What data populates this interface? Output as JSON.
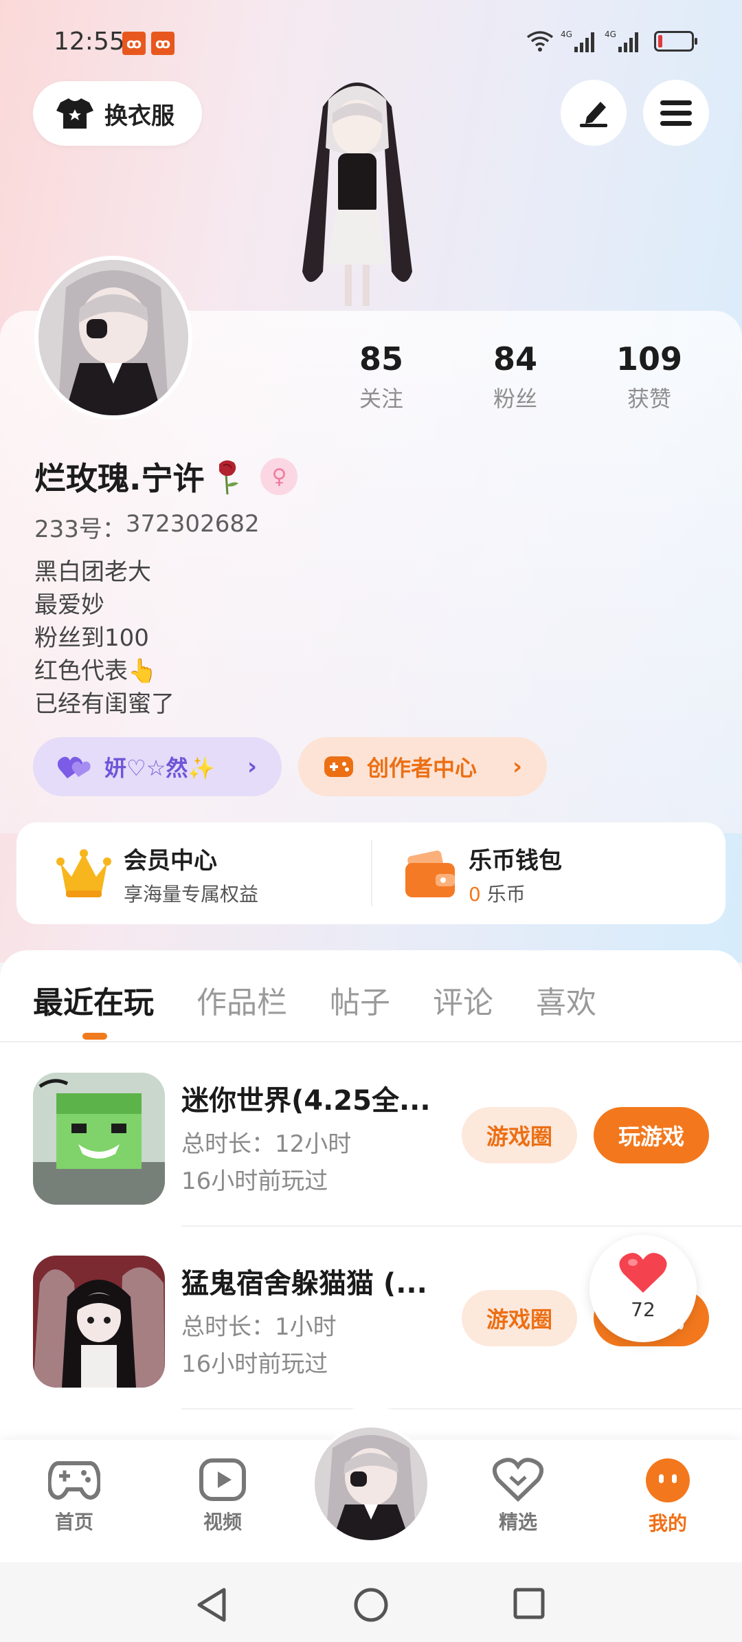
{
  "status_bar": {
    "time": "12:55",
    "notifications": [
      "app-badge",
      "app-badge"
    ],
    "network": [
      "wifi",
      "4G",
      "4G"
    ],
    "battery_level": 0.12
  },
  "top_bar": {
    "outfit_button_label": "换衣服"
  },
  "profile": {
    "stats": [
      {
        "value": "85",
        "label": "关注"
      },
      {
        "value": "84",
        "label": "粉丝"
      },
      {
        "value": "109",
        "label": "获赞"
      }
    ],
    "username": "烂玫瑰.宁许",
    "gender": "female",
    "uid_label": "233号：",
    "uid_value": "372302682",
    "bio_lines": [
      "黑白团老大",
      "最爱妙",
      "粉丝到100",
      "红色代表👆",
      "已经有闺蜜了"
    ],
    "partner_pill_label": "妍♡☆然✨",
    "creator_pill_label": "创作者中心"
  },
  "services": {
    "member": {
      "title": "会员中心",
      "subtitle": "享海量专属权益"
    },
    "wallet": {
      "title": "乐币钱包",
      "balance": "0",
      "unit": "乐币"
    }
  },
  "tabs": [
    {
      "label": "最近在玩",
      "active": true
    },
    {
      "label": "作品栏",
      "active": false
    },
    {
      "label": "帖子",
      "active": false
    },
    {
      "label": "评论",
      "active": false
    },
    {
      "label": "喜欢",
      "active": false
    }
  ],
  "games": [
    {
      "title": "迷你世界(4.25全...",
      "duration": "总时长：12小时",
      "last_played": "16小时前玩过",
      "circle_label": "游戏圈",
      "play_label": "玩游戏"
    },
    {
      "title": "猛鬼宿舍躲猫猫 (...",
      "duration": "总时长：1小时",
      "last_played": "16小时前玩过",
      "circle_label": "游戏圈",
      "play_label": "玩游戏"
    }
  ],
  "like_float": {
    "count": "72"
  },
  "bottom_nav": [
    {
      "label": "首页",
      "icon": "gamepad-icon",
      "active": false
    },
    {
      "label": "视频",
      "icon": "video-icon",
      "active": false
    },
    {
      "label": "",
      "icon": "avatar",
      "active": false
    },
    {
      "label": "精选",
      "icon": "heart-badge-icon",
      "active": false
    },
    {
      "label": "我的",
      "icon": "face-icon",
      "active": true
    }
  ],
  "colors": {
    "accent": "#f3781d",
    "purple": "#6e55d8",
    "gender_pink": "#f07ba0"
  }
}
